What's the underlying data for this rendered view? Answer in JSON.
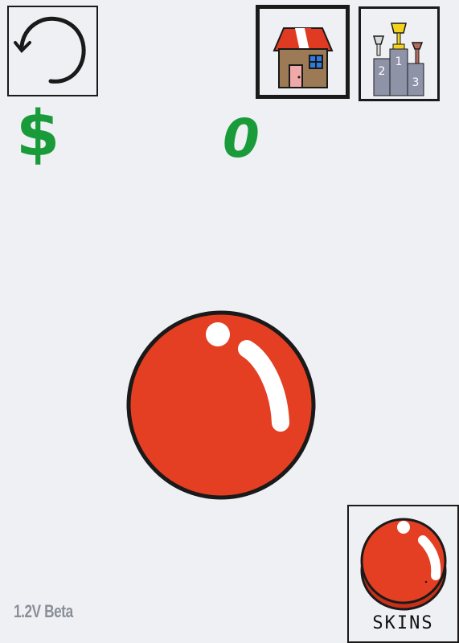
{
  "hud": {
    "currency_symbol": "$",
    "score": "0"
  },
  "buttons": {
    "reset_icon": "reset-icon",
    "shop_icon": "house-icon",
    "leaderboard_icon": "podium-icon",
    "skins_label": "SKINS",
    "podium_places": [
      "1",
      "2",
      "3"
    ]
  },
  "footer": {
    "version": "1.2V Beta"
  },
  "colors": {
    "background": "#eef0f4",
    "money_green": "#1a9b3a",
    "ball_red": "#e43f22",
    "outline": "#1a1a1a"
  }
}
